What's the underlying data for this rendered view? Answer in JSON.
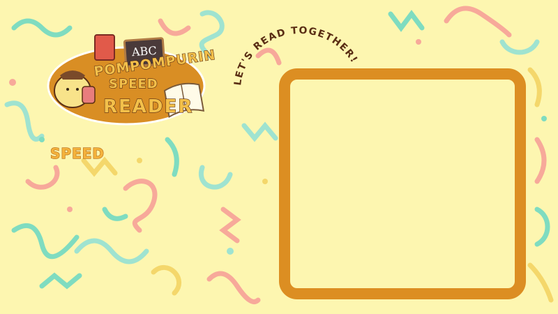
{
  "logo": {
    "brand": "Pompompurin",
    "subtitle": "Speed",
    "title": "Reader",
    "chalkboard_text": "ABC"
  },
  "speed_label": "SPEED",
  "arc_text": "LET'S READ TOGETHER!",
  "colors": {
    "background": "#fdf6b0",
    "frame": "#dc8e22",
    "logo_badge": "#d98e24",
    "text_dark": "#5a2e14",
    "confetti": [
      "#7fdcc0",
      "#f7a99a",
      "#f4d76b",
      "#9fe3d0"
    ]
  }
}
